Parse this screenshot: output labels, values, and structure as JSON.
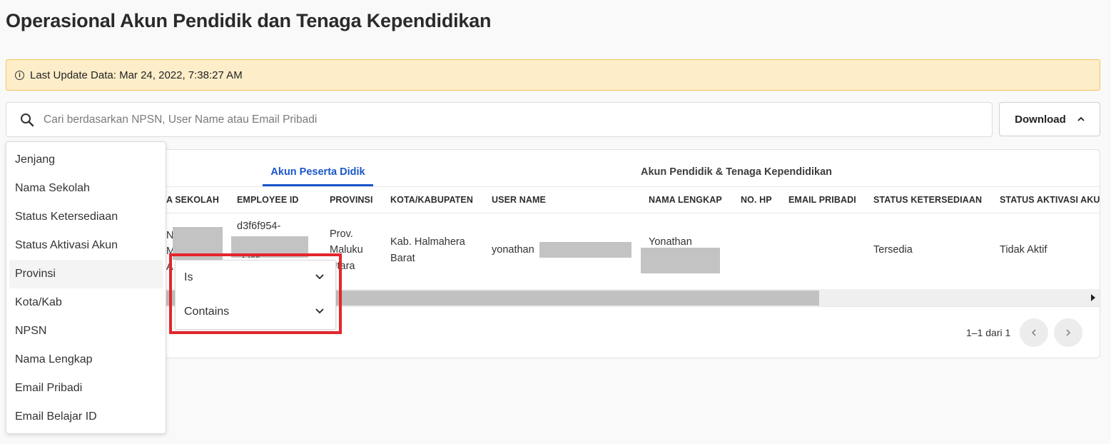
{
  "page": {
    "title": "Operasional Akun Pendidik dan Tenaga Kependidikan"
  },
  "notice": {
    "icon": "info-icon",
    "text": "Last Update Data: Mar 24, 2022, 7:38:27 AM",
    "bg": "#fdeec9",
    "border": "#f2c45a"
  },
  "search": {
    "placeholder": "Cari berdasarkan NPSN, User Name atau Email Pribadi",
    "value": ""
  },
  "toolbar": {
    "download_label": "Download"
  },
  "tabs": [
    {
      "label": "Akun Peserta Didik",
      "active": true
    },
    {
      "label": "Akun Pendidik & Tenaga Kependidikan",
      "active": false
    }
  ],
  "table": {
    "columns": [
      "A SEKOLAH",
      "EMPLOYEE ID",
      "PROVINSI",
      "KOTA/KABUPATEN",
      "USER NAME",
      "NAMA LENGKAP",
      "NO. HP",
      "EMAIL PRIBADI",
      "STATUS KETERSEDIAAN",
      "STATUS AKTIVASI AKU"
    ],
    "rows": [
      {
        "sekolah": "N M A",
        "employee_id_line1": "d3f6f954-",
        "employee_id_line3": "c1455",
        "provinsi_line1": "Prov.",
        "provinsi_line2": "Maluku",
        "provinsi_line3": "Utara",
        "kota_line1": "Kab. Halmahera",
        "kota_line2": "Barat",
        "user_name": "yonathan",
        "nama_lengkap": "Yonathan",
        "no_hp": "",
        "email_pribadi": "",
        "status_ketersediaan": "Tersedia",
        "status_aktivasi": "Tidak Aktif"
      }
    ]
  },
  "pagination": {
    "text": "1–1 dari 1"
  },
  "filter_menu": {
    "items": [
      "Jenjang",
      "Nama Sekolah",
      "Status Ketersediaan",
      "Status Aktivasi Akun",
      "Provinsi",
      "Kota/Kab",
      "NPSN",
      "Nama Lengkap",
      "Email Pribadi",
      "Email Belajar ID"
    ],
    "active": "Provinsi"
  },
  "filter_operator": {
    "options": [
      "Is",
      "Contains"
    ]
  },
  "colors": {
    "accent": "#1a56c9",
    "highlight": "#e3262c"
  }
}
